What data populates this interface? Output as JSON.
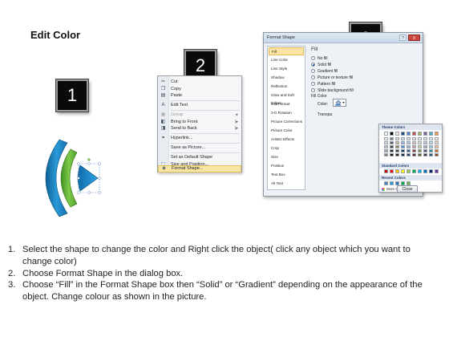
{
  "title": "Edit Color",
  "step_badges": [
    "1",
    "2",
    "3"
  ],
  "context_menu": {
    "items": [
      {
        "label": "Cut",
        "icon": "scissors-icon",
        "glyph": "✂"
      },
      {
        "label": "Copy",
        "icon": "copy-icon",
        "glyph": "❐"
      },
      {
        "label": "Paste",
        "icon": "paste-icon",
        "glyph": "▤"
      },
      {
        "label": "Edit Text",
        "icon": "edit-text-icon",
        "glyph": "A"
      },
      {
        "label": "Group",
        "icon": "group-icon",
        "glyph": "▣",
        "disabled": true,
        "submenu": true
      },
      {
        "label": "Bring to Front",
        "icon": "bring-front-icon",
        "glyph": "◧",
        "submenu": true
      },
      {
        "label": "Send to Back",
        "icon": "send-back-icon",
        "glyph": "◨",
        "submenu": true
      },
      {
        "label": "Hyperlink...",
        "icon": "hyperlink-icon",
        "glyph": "⚭"
      },
      {
        "label": "Save as Picture...",
        "icon": "",
        "glyph": ""
      },
      {
        "label": "Set as Default Shape",
        "icon": "",
        "glyph": ""
      },
      {
        "label": "Size and Position...",
        "icon": "size-position-icon",
        "glyph": "⬚"
      },
      {
        "label": "Format Shape...",
        "icon": "format-shape-icon",
        "glyph": "◈",
        "highlighted": true
      }
    ]
  },
  "dialog": {
    "title": "Format Shape",
    "help_label": "?",
    "close_label": "X",
    "categories": [
      "Fill",
      "Line Color",
      "Line Style",
      "Shadow",
      "Reflection",
      "Glow and Soft Edges",
      "3-D Format",
      "3-D Rotation",
      "Picture Corrections",
      "Picture Color",
      "Artistic Effects",
      "Crop",
      "Size",
      "Position",
      "Text Box",
      "Alt Text"
    ],
    "active_category": "Fill",
    "fill": {
      "heading": "Fill",
      "options": [
        {
          "label": "No fill",
          "selected": false
        },
        {
          "label": "Solid fill",
          "selected": true
        },
        {
          "label": "Gradient fill",
          "selected": false
        },
        {
          "label": "Picture or texture fill",
          "selected": false
        },
        {
          "label": "Pattern fill",
          "selected": false
        },
        {
          "label": "Slide background fill",
          "selected": false
        }
      ],
      "fill_color_label": "Fill Color",
      "color_label": "Color:",
      "transparency_label": "Transpa"
    },
    "palette": {
      "theme_heading": "Theme Colors",
      "standard_heading": "Standard Colors",
      "recent_heading": "Recent Colors",
      "more_colors": "More Colors...",
      "theme_top": [
        "#ffffff",
        "#000000",
        "#eeece1",
        "#1f497d",
        "#4f81bd",
        "#c0504d",
        "#9bbb59",
        "#8064a2",
        "#4bacc6",
        "#f79646"
      ],
      "theme_shades": [
        [
          "#f2f2f2",
          "#7f7f7f",
          "#ddd9c3",
          "#c6d9f0",
          "#dbe5f1",
          "#f2dcdb",
          "#ebf1dd",
          "#e5e0ec",
          "#dbeef3",
          "#fdeada"
        ],
        [
          "#d8d8d8",
          "#595959",
          "#c4bd97",
          "#8db3e2",
          "#b8cce4",
          "#e5b9b7",
          "#d7e3bc",
          "#ccc1d9",
          "#b7dde8",
          "#fbd5b5"
        ],
        [
          "#bfbfbf",
          "#3f3f3f",
          "#938953",
          "#548dd4",
          "#95b3d7",
          "#d99694",
          "#c3d69b",
          "#b2a2c7",
          "#92cddc",
          "#fac08f"
        ],
        [
          "#a5a5a5",
          "#262626",
          "#494429",
          "#17365d",
          "#366092",
          "#953734",
          "#76923c",
          "#5f497a",
          "#31859b",
          "#e36c09"
        ],
        [
          "#7f7f7f",
          "#0c0c0c",
          "#1d1b10",
          "#0f243e",
          "#244061",
          "#632423",
          "#4f6128",
          "#3f3151",
          "#205867",
          "#974806"
        ]
      ],
      "standard": [
        "#c00000",
        "#ff0000",
        "#ffc000",
        "#ffff00",
        "#92d050",
        "#00b050",
        "#00b0f0",
        "#0070c0",
        "#002060",
        "#7030a0"
      ],
      "recent": [
        "#4f81bd",
        "#1f9ad6",
        "#2e75b6",
        "#00b050",
        "#70ad47"
      ]
    },
    "close_button": "Close"
  },
  "instructions": [
    {
      "num": "1.",
      "text": "Select the shape to change the color and Right click the object( click any object which you want to change color)"
    },
    {
      "num": "2.",
      "text": "Choose Format Shape in the dialog box."
    },
    {
      "num": "3.",
      "text": "Choose “Fill” in the Format Shape box then “Solid” or “Gradient” depending on the appearance of the object. Change colour as shown in the picture."
    }
  ],
  "colors": {
    "shape_blue": "#1e88c8",
    "shape_green": "#6cbf3c",
    "selection_handle": "#7aa6d8",
    "menu_highlight": "#f7e6a6",
    "close_red": "#c9453a"
  }
}
